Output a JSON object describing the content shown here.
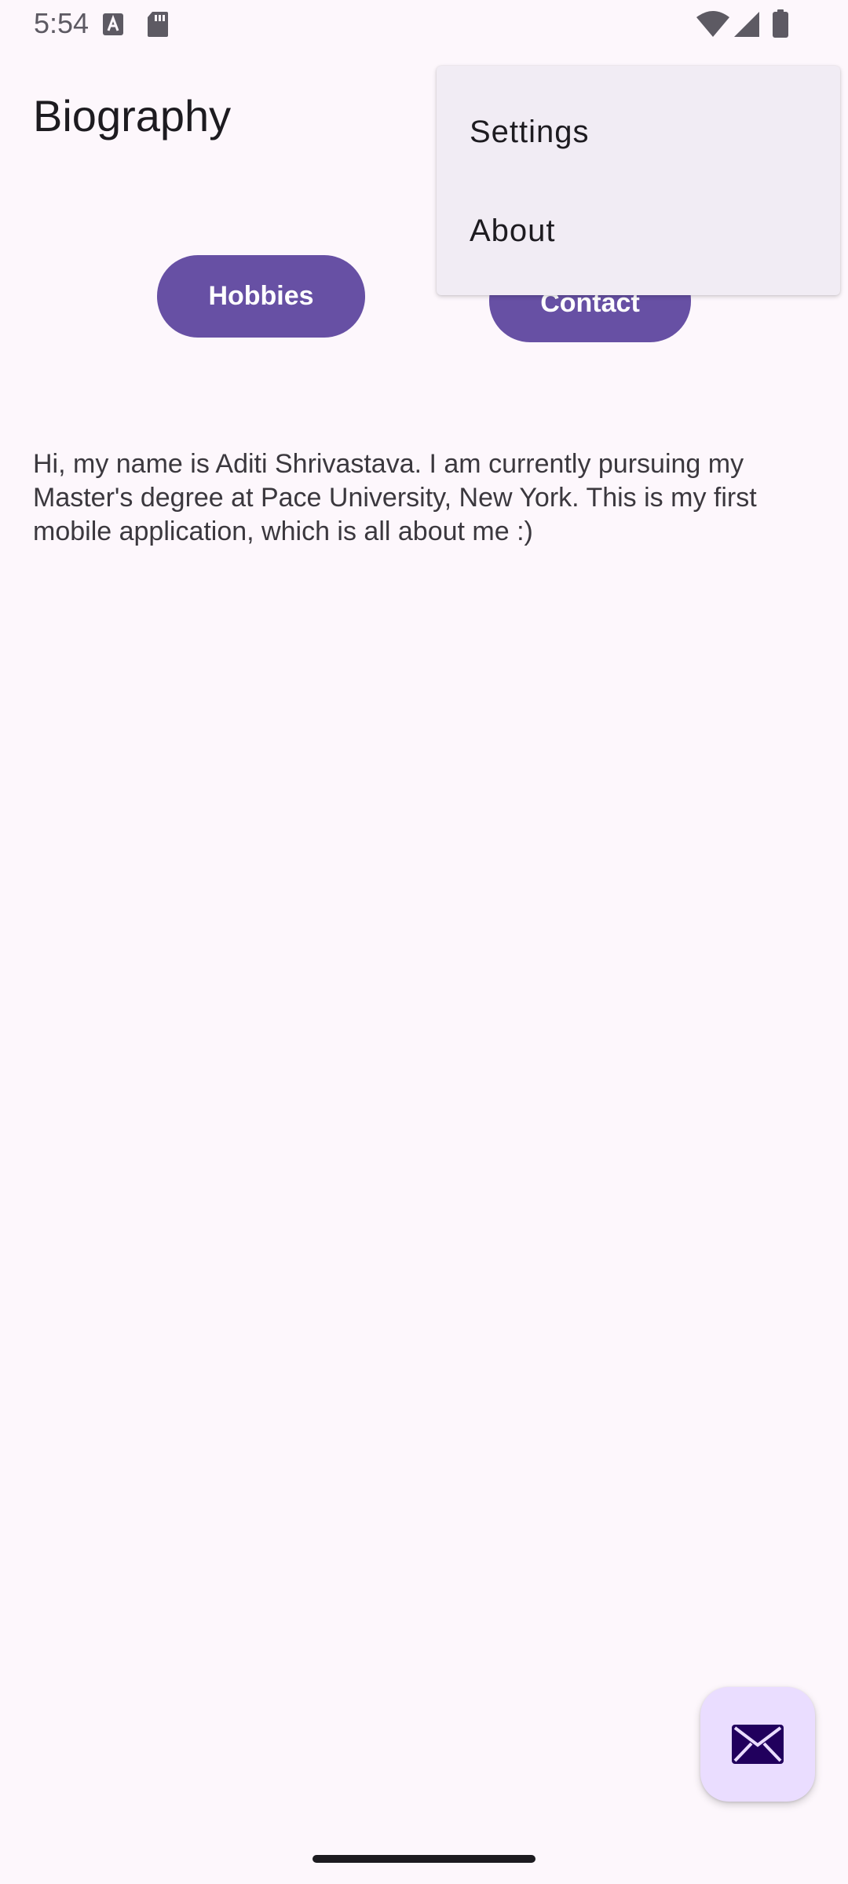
{
  "status_bar": {
    "time": "5:54",
    "icons": [
      "text-a-icon",
      "sd-card-icon",
      "wifi-icon",
      "cellular-signal-icon",
      "battery-icon"
    ]
  },
  "toolbar": {
    "title": "Biography"
  },
  "buttons": {
    "hobbies_label": "Hobbies",
    "contact_label": "Contact"
  },
  "bio": {
    "text": "Hi, my name is Aditi Shrivastava. I am currently pursuing my Master's degree at Pace University, New York. This is my first mobile application, which is all about me :)"
  },
  "overflow_menu": {
    "items": [
      {
        "label": "Settings"
      },
      {
        "label": "About"
      }
    ]
  },
  "fab": {
    "icon": "mail-icon"
  },
  "colors": {
    "background": "#fdf7fc",
    "primary": "#6750a4",
    "on_primary": "#ffffff",
    "fab_container": "#eaddff",
    "fab_icon": "#21005d",
    "menu_surface": "#f1ecf4",
    "text_primary": "#1d1b20"
  }
}
